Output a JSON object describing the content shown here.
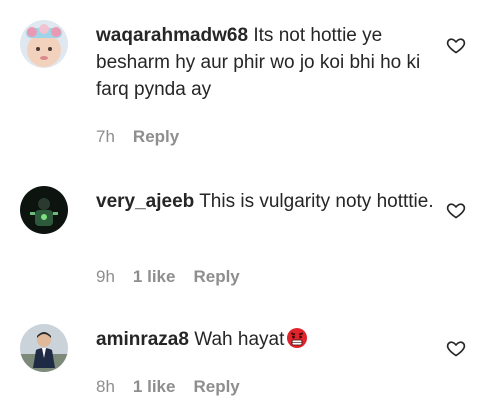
{
  "comments": [
    {
      "username": "waqarahmadw68",
      "text": "Its not hottie ye besharm hy aur phir wo jo koi bhi ho ki farq pynda ay",
      "time": "7h",
      "likes": "",
      "reply_label": "Reply",
      "avatar": "girl-with-flower-crown-avatar"
    },
    {
      "username": "very_ajeeb",
      "text": "This is vulgarity noty hotttie.",
      "time": "9h",
      "likes": "1 like",
      "reply_label": "Reply",
      "avatar": "person-on-dark-background-avatar"
    },
    {
      "username": "aminraza8",
      "text": "Wah hayat",
      "emoji": "angry-face-emoji",
      "time": "8h",
      "likes": "1 like",
      "reply_label": "Reply",
      "avatar": "man-in-suit-avatar"
    }
  ],
  "icons": {
    "like": "heart-outline-icon"
  },
  "colors": {
    "text": "#262626",
    "meta": "#8e8e8e",
    "background": "#ffffff"
  }
}
